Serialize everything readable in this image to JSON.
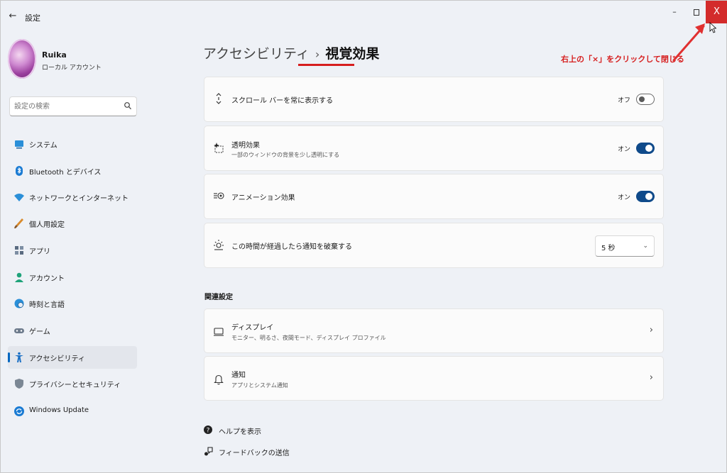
{
  "window": {
    "title": "設定",
    "back_glyph": "←",
    "min_glyph": "–",
    "close_glyph": "X"
  },
  "profile": {
    "name": "Ruika",
    "account_type": "ローカル アカウント"
  },
  "search": {
    "placeholder": "設定の検索"
  },
  "sidebar": {
    "items": [
      {
        "label": "システム",
        "icon": "system-icon"
      },
      {
        "label": "Bluetooth とデバイス",
        "icon": "bluetooth-icon"
      },
      {
        "label": "ネットワークとインターネット",
        "icon": "network-icon"
      },
      {
        "label": "個人用設定",
        "icon": "brush-icon"
      },
      {
        "label": "アプリ",
        "icon": "apps-icon"
      },
      {
        "label": "アカウント",
        "icon": "account-icon"
      },
      {
        "label": "時刻と言語",
        "icon": "globe-clock-icon"
      },
      {
        "label": "ゲーム",
        "icon": "gamepad-icon"
      },
      {
        "label": "アクセシビリティ",
        "icon": "accessibility-icon",
        "active": true
      },
      {
        "label": "プライバシーとセキュリティ",
        "icon": "shield-icon"
      },
      {
        "label": "Windows Update",
        "icon": "update-icon"
      }
    ]
  },
  "breadcrumb": {
    "parent": "アクセシビリティ",
    "separator": "›",
    "current": "視覚効果"
  },
  "annotation": {
    "text": "右上の「×」をクリックして閉じる",
    "color": "#d61e1e"
  },
  "settings": [
    {
      "title": "スクロール バーを常に表示する",
      "state": "オフ",
      "toggle": "off"
    },
    {
      "title": "透明効果",
      "desc": "一部のウィンドウの背景を少し透明にする",
      "state": "オン",
      "toggle": "on"
    },
    {
      "title": "アニメーション効果",
      "state": "オン",
      "toggle": "on"
    },
    {
      "title": "この時間が経過したら通知を破棄する",
      "dropdown": "5 秒"
    }
  ],
  "related": {
    "heading": "関連設定",
    "items": [
      {
        "title": "ディスプレイ",
        "desc": "モニター、明るさ、夜間モード、ディスプレイ プロファイル"
      },
      {
        "title": "通知",
        "desc": "アプリとシステム通知"
      }
    ]
  },
  "footer": {
    "help": "ヘルプを表示",
    "feedback": "フィードバックの送信"
  },
  "colors": {
    "accent": "#0067c0",
    "toggle_on": "#0f4a8a",
    "close_button": "#d32b2b"
  }
}
